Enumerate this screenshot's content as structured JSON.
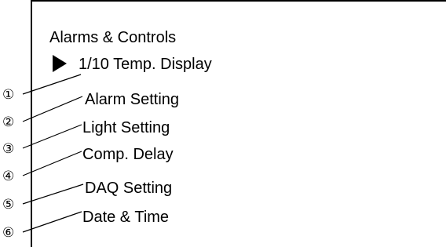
{
  "menu": {
    "title": "Alarms & Controls",
    "items": [
      {
        "label": "1/10 Temp. Display",
        "selected": true
      },
      {
        "label": "Alarm Setting",
        "selected": false
      },
      {
        "label": "Light Setting",
        "selected": false
      },
      {
        "label": "Comp. Delay",
        "selected": false
      },
      {
        "label": "DAQ Setting",
        "selected": false
      },
      {
        "label": "Date & Time",
        "selected": false
      }
    ],
    "selection_icon": "play-triangle-icon"
  },
  "callouts": [
    {
      "marker": "①"
    },
    {
      "marker": "②"
    },
    {
      "marker": "③"
    },
    {
      "marker": "④"
    },
    {
      "marker": "⑤"
    },
    {
      "marker": "⑥"
    }
  ],
  "colors": {
    "foreground": "#000000",
    "background": "#ffffff"
  }
}
